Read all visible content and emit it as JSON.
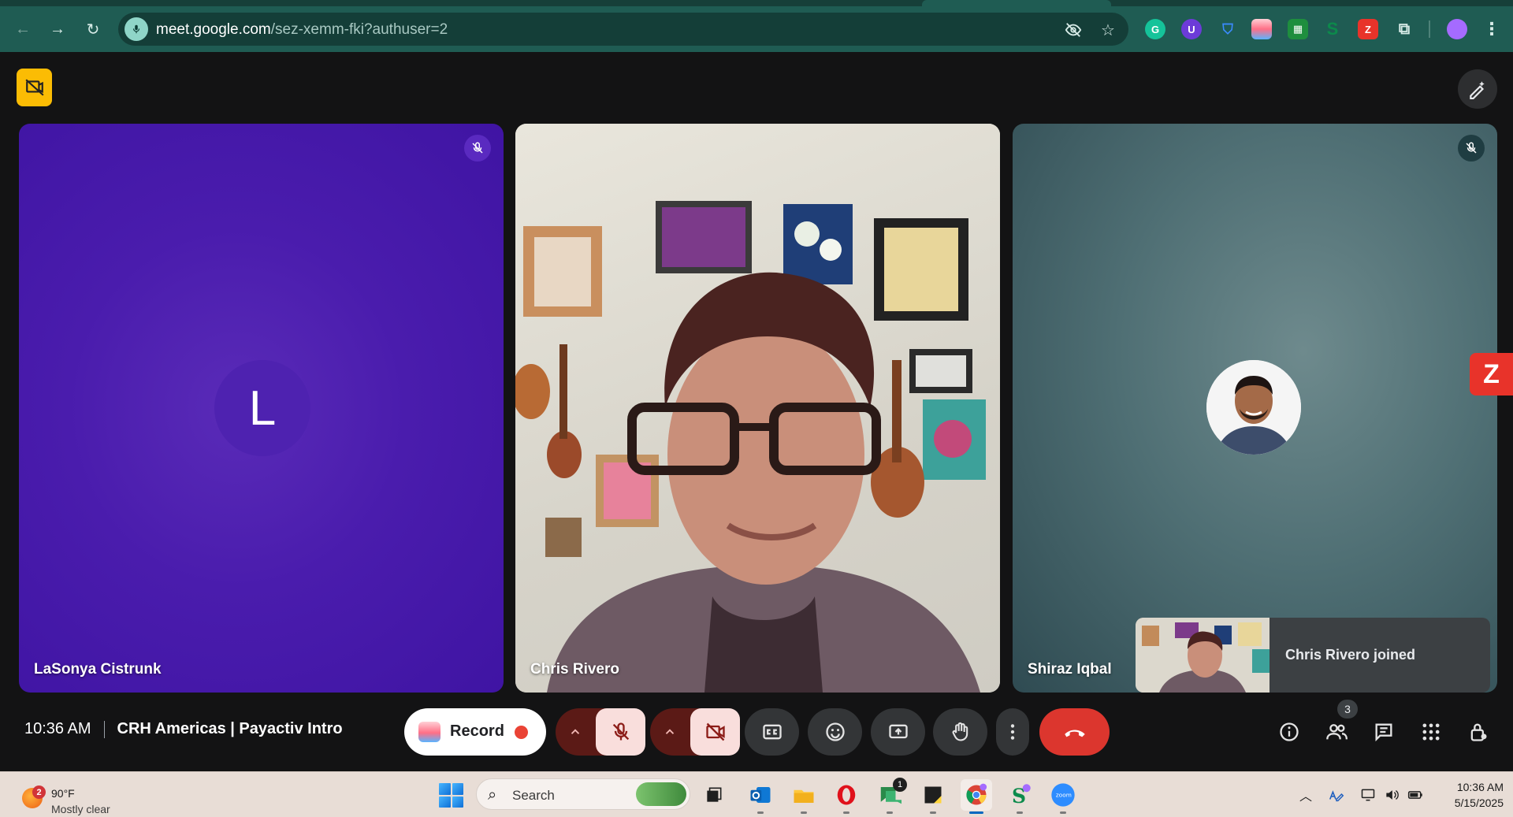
{
  "browser": {
    "url_host": "meet.google.com",
    "url_path": "/sez-xemm-fki?authuser=2",
    "colors": {
      "frame": "#1f5c53",
      "omnibox": "#143e38"
    }
  },
  "tiles": [
    {
      "name": "LaSonya Cistrunk",
      "avatar_letter": "L",
      "muted": true,
      "bg": "#4a1cad"
    },
    {
      "name": "Chris Rivero",
      "muted": false,
      "video_on": true
    },
    {
      "name": "Shiraz Iqbal",
      "muted": true,
      "bg": "#4f6f74"
    }
  ],
  "toast": {
    "text": "Chris Rivero joined"
  },
  "bottom_bar": {
    "time": "10:36 AM",
    "meeting_title": "CRH Americas | Payactiv Intro",
    "record_label": "Record",
    "participants_count": "3"
  },
  "extension_badge": {
    "letter": "Z",
    "color": "#e8332a"
  },
  "taskbar": {
    "weather": {
      "temp": "90°F",
      "condition": "Mostly clear",
      "badge": "2"
    },
    "search_label": "Search",
    "teams_badge": "1",
    "clock_time": "10:36 AM",
    "clock_date": "5/15/2025"
  }
}
